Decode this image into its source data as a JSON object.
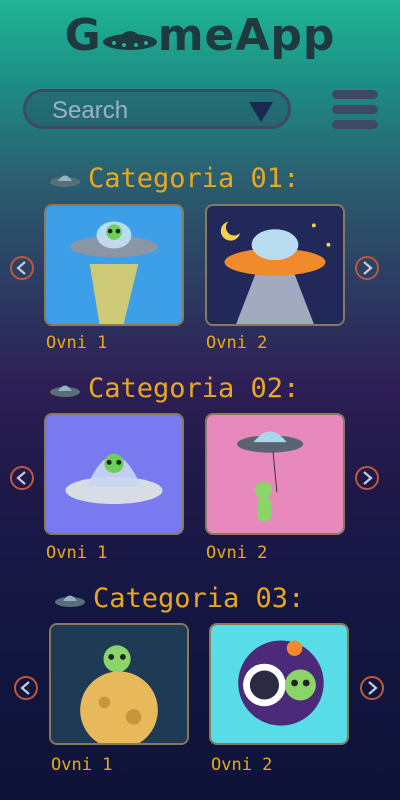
{
  "app": {
    "logo_prefix": "G",
    "logo_suffix": "meApp"
  },
  "search": {
    "placeholder": "Search"
  },
  "colors": {
    "accent": "#e9a820",
    "ui_dark": "#3d4a66",
    "arrow": "#c0583a"
  },
  "icons": {
    "logo": "ufo-icon",
    "dropdown": "triangle-down-icon",
    "menu": "hamburger-menu-icon",
    "prev": "chevron-left-icon",
    "next": "chevron-right-icon"
  },
  "categories": [
    {
      "title": "Categoria 01:",
      "items": [
        {
          "label": "Ovni 1"
        },
        {
          "label": "Ovni 2"
        }
      ]
    },
    {
      "title": "Categoria 02:",
      "items": [
        {
          "label": "Ovni 1"
        },
        {
          "label": "Ovni 2"
        }
      ]
    },
    {
      "title": "Categoria 03:",
      "items": [
        {
          "label": "Ovni 1"
        },
        {
          "label": "Ovni 2"
        }
      ]
    }
  ]
}
